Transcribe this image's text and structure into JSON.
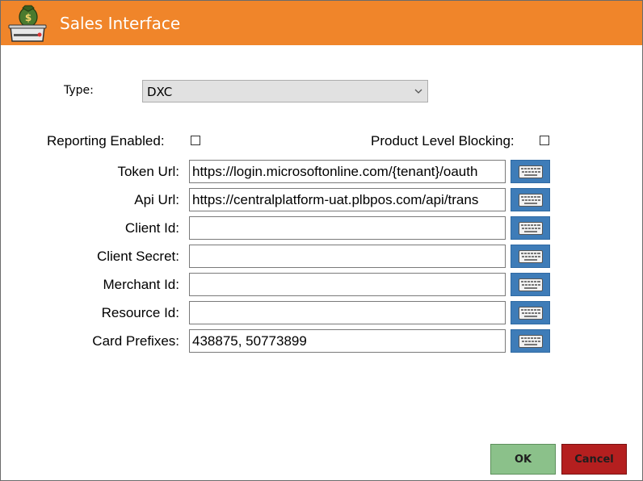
{
  "window": {
    "title": "Sales Interface",
    "title_icon": "cash-register-icon",
    "accent_color": "#f0852a"
  },
  "type": {
    "label": "Type:",
    "value": "DXC"
  },
  "options": {
    "reporting_enabled_label": "Reporting Enabled:",
    "reporting_enabled_checked": false,
    "product_level_blocking_label": "Product Level Blocking:",
    "product_level_blocking_checked": false
  },
  "fields": [
    {
      "label": "Token Url:",
      "value": "https://login.microsoftonline.com/{tenant}/oauth"
    },
    {
      "label": "Api Url:",
      "value": "https://centralplatform-uat.plbpos.com/api/trans"
    },
    {
      "label": "Client Id:",
      "value": ""
    },
    {
      "label": "Client Secret:",
      "value": ""
    },
    {
      "label": "Merchant Id:",
      "value": ""
    },
    {
      "label": "Resource Id:",
      "value": ""
    },
    {
      "label": "Card Prefixes:",
      "value": "438875, 50773899"
    }
  ],
  "keyboard_icon": "keyboard-icon",
  "buttons": {
    "ok": "OK",
    "cancel": "Cancel",
    "ok_color": "#8bc18a",
    "cancel_color": "#b41f1f"
  }
}
